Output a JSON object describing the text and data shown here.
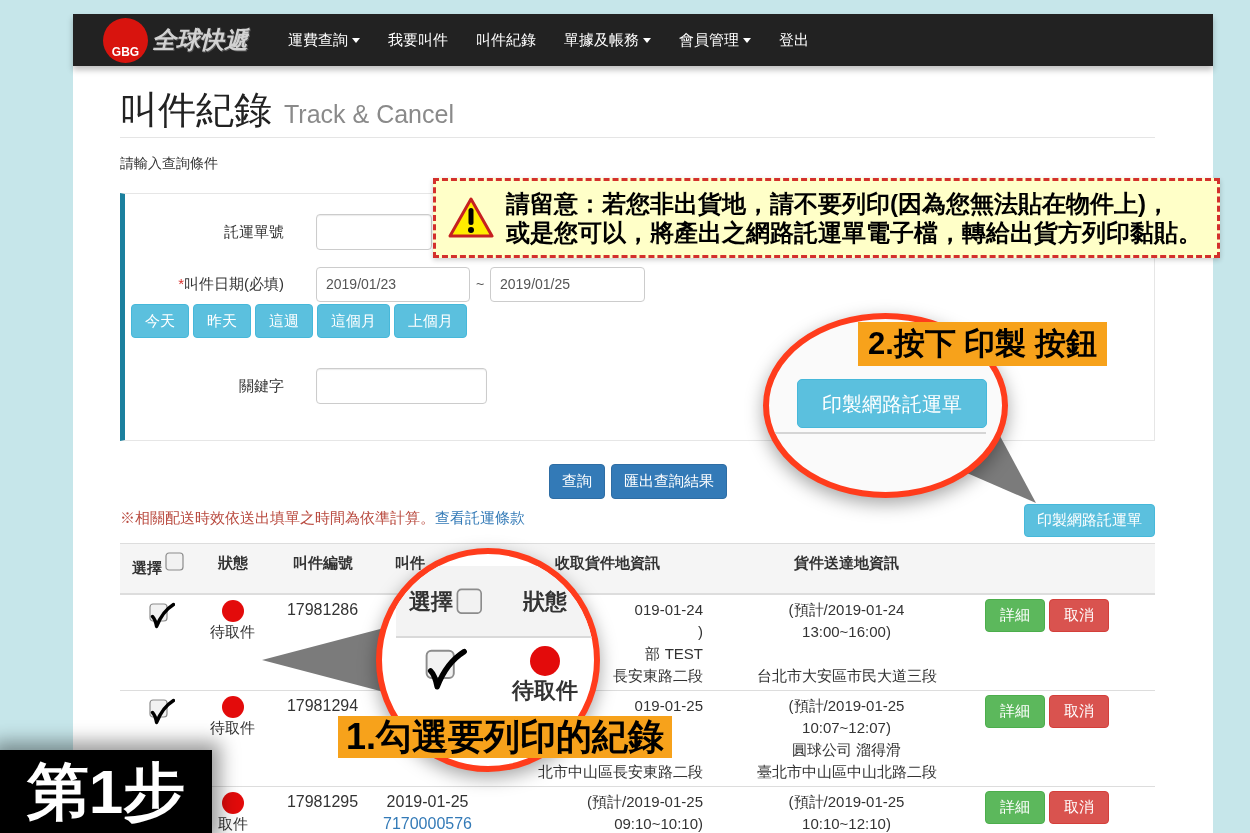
{
  "nav": {
    "logo": {
      "badge": "GBG",
      "name": "全球快遞"
    },
    "items": [
      {
        "label": "運費查詢",
        "dropdown": true
      },
      {
        "label": "我要叫件",
        "dropdown": false
      },
      {
        "label": "叫件紀錄",
        "dropdown": false
      },
      {
        "label": "單據及帳務",
        "dropdown": true
      },
      {
        "label": "會員管理",
        "dropdown": true
      },
      {
        "label": "登出",
        "dropdown": false
      }
    ]
  },
  "heading": {
    "title": "叫件紀錄",
    "subtitle": "Track & Cancel"
  },
  "prompt": "請輸入查詢條件",
  "search_form": {
    "rows": [
      {
        "kind": "text",
        "label": "託運單號"
      },
      {
        "kind": "date_range",
        "marker": "*",
        "label": "叫件日期(必填)",
        "from": "2019/01/23",
        "separator": "~",
        "to": "2019/01/25"
      },
      {
        "kind": "buttons",
        "buttons": [
          "今天",
          "昨天",
          "這週",
          "這個月",
          "上個月"
        ]
      },
      {
        "kind": "text",
        "label": "關鍵字"
      }
    ]
  },
  "search_actions": [
    "查詢",
    "匯出查詢結果"
  ],
  "notice": {
    "text": "※相關配送時效依送出填單之時間為依準計算。",
    "link": "查看託運條款"
  },
  "print_button": "印製網路託運單",
  "table": {
    "columns": [
      "選擇",
      "狀態",
      "叫件編號",
      "叫件",
      "收取貨件地資訊",
      "貨件送達地資訊"
    ],
    "select_all": {
      "checked": false
    },
    "rows": [
      {
        "checked": true,
        "status": {
          "label": "待取件",
          "color": "#e30b0b"
        },
        "number": "17981286",
        "pickup": {
          "schedule": [
            "019-01-24",
            ")"
          ],
          "contact": "部 TEST",
          "address": "長安東路二段"
        },
        "delivery": {
          "schedule": [
            "(預計/2019-01-24",
            "13:00~16:00)"
          ],
          "address": "台北市大安區市民大道三段"
        },
        "actions": [
          {
            "label": "詳細",
            "kind": "details"
          },
          {
            "label": "取消",
            "kind": "cancel"
          }
        ]
      },
      {
        "checked": true,
        "status": {
          "label": "待取件",
          "color": "#e30b0b"
        },
        "number": "17981294",
        "pickup": {
          "schedule": [
            "019-01-25"
          ],
          "address": "北市中山區長安東路二段"
        },
        "delivery": {
          "schedule": [
            "(預計/2019-01-25",
            "10:07~12:07)"
          ],
          "contact": "圓球公司 溜得滑",
          "address": "臺北市中山區中山北路二段"
        },
        "actions": [
          {
            "label": "詳細",
            "kind": "details"
          },
          {
            "label": "取消",
            "kind": "cancel"
          }
        ]
      },
      {
        "status": {
          "label": "取件",
          "color": "#e30b0b"
        },
        "number": "17981295",
        "date": {
          "date": "2019-01-25",
          "link": "7170000576"
        },
        "pickup": {
          "schedule": [
            "(預計/2019-01-25",
            "09:10~10:10)"
          ]
        },
        "delivery": {
          "schedule": [
            "(預計/2019-01-25",
            "10:10~12:10)"
          ]
        },
        "actions": [
          {
            "label": "詳細",
            "kind": "details"
          },
          {
            "label": "取消",
            "kind": "cancel"
          }
        ]
      }
    ]
  },
  "warning": {
    "lines": [
      "請留意：若您非出貨地，請不要列印(因為您無法貼在物件上)，",
      "或是您可以，將產出之網路託運單電子檔，轉給出貨方列印黏貼。"
    ]
  },
  "callouts": [
    {
      "kind": "records",
      "label": "1.勾選要列印的紀錄",
      "zoom": {
        "columns": [
          "選擇",
          "狀態"
        ],
        "select_all_checked": false,
        "checked": true,
        "status": {
          "label": "待取件",
          "color": "#e30b0b"
        }
      }
    },
    {
      "kind": "print",
      "label": "2.按下 印製 按鈕",
      "zoom": {
        "button": "印製網路託運單"
      }
    }
  ],
  "step_label": "第1步"
}
